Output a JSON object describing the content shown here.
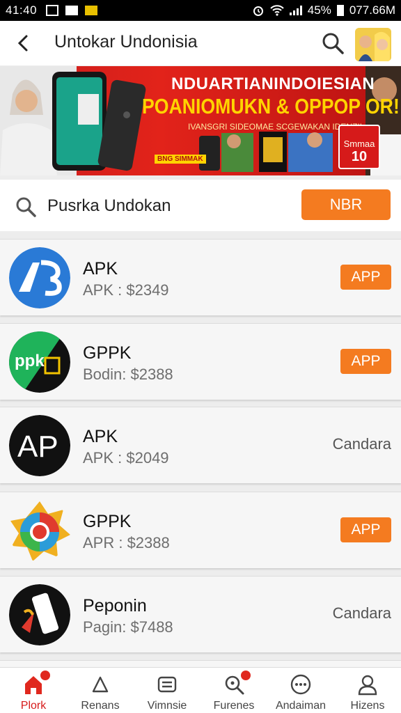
{
  "status_bar": {
    "time": "41:40",
    "battery": "45%",
    "right_text": "077.66M"
  },
  "header": {
    "back_icon": "back-arrow-icon",
    "title": "Untokar Undonisia",
    "search_icon": "search-icon"
  },
  "banner": {
    "headline": "NDUARTIANINDOIESIAN",
    "subheadline": "POANIOMUKN & OPPOP OR!!",
    "tagline": "IVANSGRI SIDEOMAE SCGEWAKAN IDENZII",
    "promo_tag": "BNG SIMMAK",
    "badge_top": "Smmaa",
    "badge_num": "10",
    "colors": {
      "bg": "#d61a1a",
      "headline": "#ffffff",
      "subheadline": "#ffd400"
    }
  },
  "search": {
    "placeholder": "Pusrka Undokan",
    "button_label": "NBR",
    "accent": "#f47b20"
  },
  "apps": [
    {
      "name": "APK",
      "subtitle": "APK : $2349",
      "action": "APP",
      "action_type": "button",
      "icon": "ab-logo-icon"
    },
    {
      "name": "GPPK",
      "subtitle": "Bodin: $2388",
      "action": "APP",
      "action_type": "button",
      "icon": "ppk-logo-icon"
    },
    {
      "name": "APK",
      "subtitle": "APK : $2049",
      "action": "Candara",
      "action_type": "text",
      "icon": "ap-logo-icon"
    },
    {
      "name": "GPPK",
      "subtitle": "APR : $2388",
      "action": "APP",
      "action_type": "button",
      "icon": "chrome-star-icon"
    },
    {
      "name": "Peponin",
      "subtitle": "Pagin: $7488",
      "action": "Candara",
      "action_type": "text",
      "icon": "phone-logo-icon"
    }
  ],
  "nav": [
    {
      "label": "Plork",
      "icon": "home-icon",
      "active": true,
      "badge": true
    },
    {
      "label": "Renans",
      "icon": "bookmark-icon",
      "active": false,
      "badge": false
    },
    {
      "label": "Vimnsie",
      "icon": "controller-icon",
      "active": false,
      "badge": false
    },
    {
      "label": "Furenes",
      "icon": "search-icon",
      "active": false,
      "badge": true
    },
    {
      "label": "Andaiman",
      "icon": "more-icon",
      "active": false,
      "badge": false
    },
    {
      "label": "Hizens",
      "icon": "profile-icon",
      "active": false,
      "badge": false
    }
  ]
}
